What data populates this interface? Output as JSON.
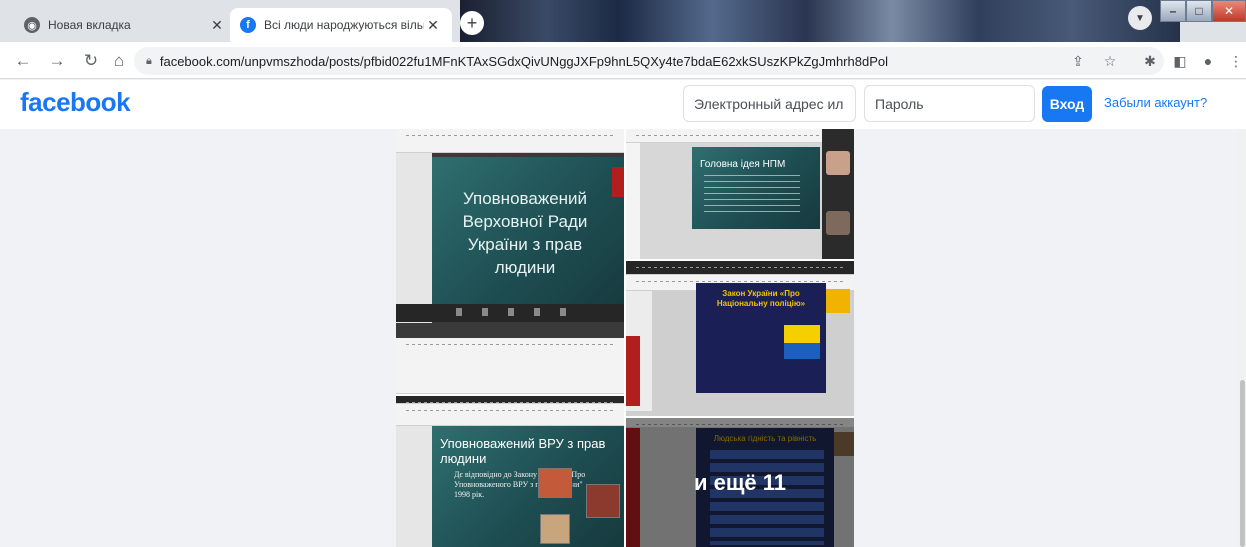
{
  "browser": {
    "tabs": [
      {
        "title": "Новая вкладка",
        "active": false
      },
      {
        "title": "Всі люди народжуються вільни",
        "active": true
      }
    ],
    "url": "facebook.com/unpvmszhoda/posts/pfbid022fu1MFnKTAxSGdxQivUNggJXFp9hnL5QXy4te7bdaE62xkSUszKPkZgJmhrh8dPol"
  },
  "facebook": {
    "logo": "facebook",
    "email_placeholder": "Электронный адрес ил",
    "password_placeholder": "Пароль",
    "login_label": "Вход",
    "forgot_label": "Забыли аккаунт?"
  },
  "post": {
    "slides": [
      {
        "title": "Уповноважений Верховної Ради України з прав людини"
      },
      {
        "title": "Головна ідея НПМ"
      },
      {
        "title": "Закон України «Про Національну поліцію»"
      },
      {
        "title": "Уповноважений ВРУ з прав людини",
        "body": "Дє відповідно до Закону України \"Про Уповноваженого ВРУ з прав людини\" 1998 рік."
      },
      {
        "title": "Людська гідність та рівність"
      }
    ],
    "more_label": "и ещё 11"
  },
  "colors": {
    "facebook_blue": "#1877f2",
    "slide_teal": "#1e4e52",
    "slide_navy": "#1a2055"
  }
}
